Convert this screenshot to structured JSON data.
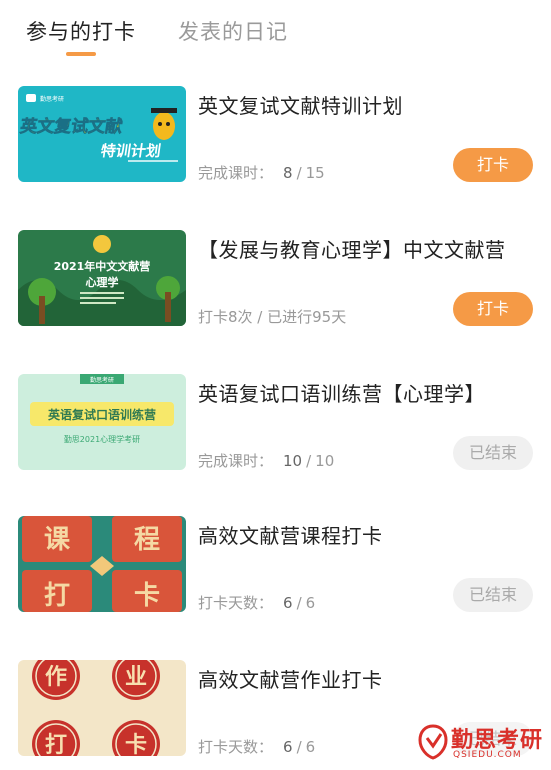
{
  "tabs": [
    {
      "label": "参与的打卡",
      "active": true
    },
    {
      "label": "发表的日记",
      "active": false
    }
  ],
  "accent_color": "#f59a46",
  "cards": [
    {
      "title": "英文复试文献特训计划",
      "meta_label": "完成课时：",
      "meta_done": "8",
      "meta_total": "15",
      "button": "打卡",
      "button_state": "active",
      "thumb": {
        "line1": "英文复试文献",
        "line2": "特训计划",
        "brand": "勤思考研"
      }
    },
    {
      "title": "【发展与教育心理学】中文文献营",
      "meta_text": "打卡8次 / 已进行95天",
      "button": "打卡",
      "button_state": "active",
      "thumb": {
        "line1": "2021年中文文献营",
        "line2": "心理学"
      }
    },
    {
      "title": "英语复试口语训练营【心理学】",
      "meta_label": "完成课时：",
      "meta_done": "10",
      "meta_total": "10",
      "button": "已结束",
      "button_state": "ended",
      "thumb": {
        "line1": "英语复试口语训练营",
        "line2": "勤思2021心理学考研",
        "brand": "勤思考研"
      }
    },
    {
      "title": "高效文献营课程打卡",
      "meta_label": "打卡天数：",
      "meta_done": "6",
      "meta_total": "6",
      "button": "已结束",
      "button_state": "ended",
      "thumb": {
        "chars": [
          "课",
          "程",
          "打",
          "卡"
        ]
      }
    },
    {
      "title": "高效文献营作业打卡",
      "meta_label": "打卡天数：",
      "meta_done": "6",
      "meta_total": "6",
      "button": "已结束",
      "button_state": "ended",
      "thumb": {
        "chars": [
          "作",
          "业",
          "打",
          "卡"
        ]
      }
    }
  ],
  "watermark": {
    "name": "勤思考研",
    "domain": "QSIEDU.COM"
  }
}
